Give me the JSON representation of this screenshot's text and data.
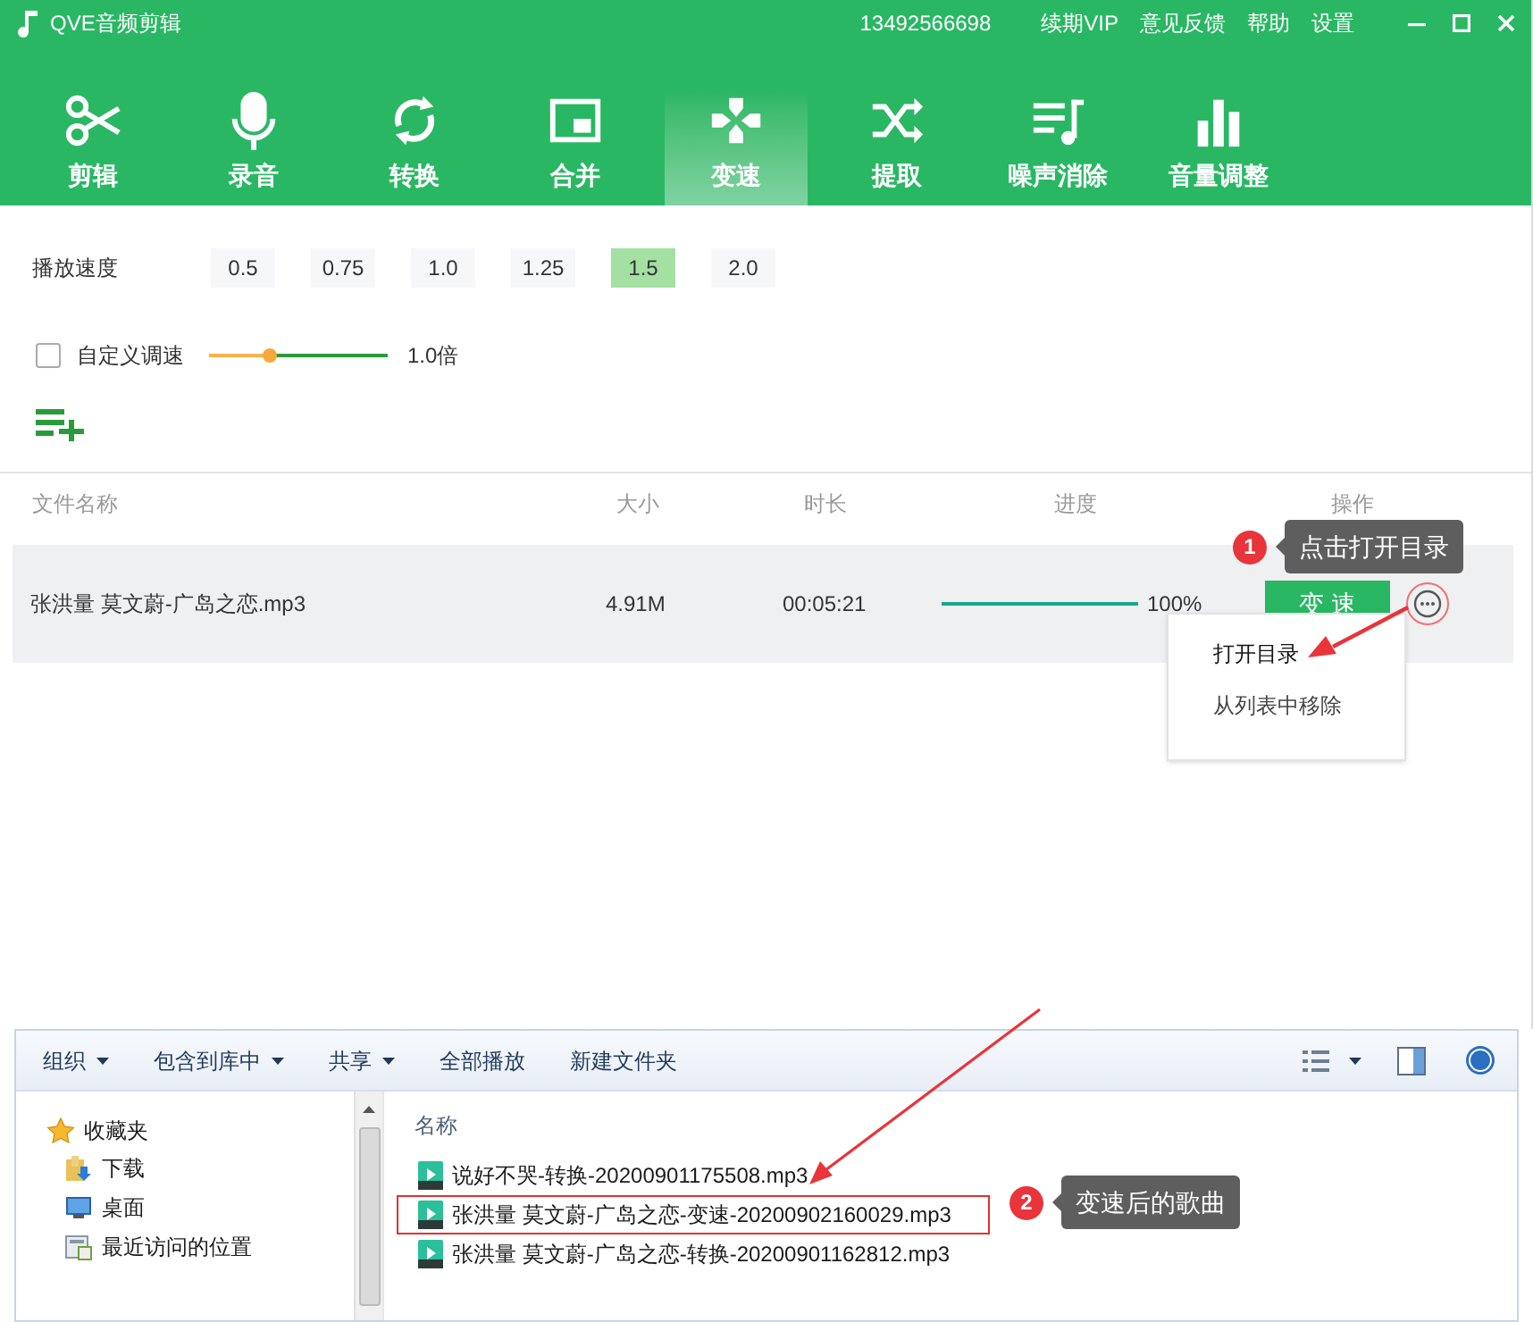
{
  "window": {
    "title": "QVE音频剪辑",
    "account": "13492566698",
    "menu": [
      "续期VIP",
      "意见反馈",
      "帮助",
      "设置"
    ]
  },
  "tools": [
    {
      "label": "剪辑",
      "selected": false
    },
    {
      "label": "录音",
      "selected": false
    },
    {
      "label": "转换",
      "selected": false
    },
    {
      "label": "合并",
      "selected": false
    },
    {
      "label": "变速",
      "selected": true
    },
    {
      "label": "提取",
      "selected": false
    },
    {
      "label": "噪声消除",
      "selected": false
    },
    {
      "label": "音量调整",
      "selected": false
    }
  ],
  "speed": {
    "label": "播放速度",
    "options": [
      {
        "label": "0.5",
        "selected": false
      },
      {
        "label": "0.75",
        "selected": false
      },
      {
        "label": "1.0",
        "selected": false
      },
      {
        "label": "1.25",
        "selected": false
      },
      {
        "label": "1.5",
        "selected": true
      },
      {
        "label": "2.0",
        "selected": false
      }
    ]
  },
  "custom_speed": {
    "label": "自定义调速",
    "checked": false,
    "level": 0.34,
    "reading": "1.0倍"
  },
  "table": {
    "columns": [
      "文件名称",
      "大小",
      "时长",
      "进度",
      "操作"
    ],
    "rows": [
      {
        "name": "张洪量 莫文蔚-广岛之恋.mp3",
        "size": "4.91M",
        "duration": "00:05:21",
        "level": 1,
        "progress": "100%",
        "action": "变 速"
      }
    ]
  },
  "context_menu": {
    "items": [
      "打开目录",
      "从列表中移除"
    ]
  },
  "callouts": [
    {
      "number": "1",
      "text": "点击打开目录"
    },
    {
      "number": "2",
      "text": "变速后的歌曲"
    }
  ],
  "explorer": {
    "toolbar": [
      {
        "label": "组织",
        "dropdown": true
      },
      {
        "label": "包含到库中",
        "dropdown": true
      },
      {
        "label": "共享",
        "dropdown": true
      },
      {
        "label": "全部播放",
        "dropdown": false
      },
      {
        "label": "新建文件夹",
        "dropdown": false
      }
    ],
    "nav": [
      {
        "label": "收藏夹",
        "children": [
          {
            "label": "下载"
          },
          {
            "label": "桌面"
          },
          {
            "label": "最近访问的位置"
          }
        ]
      }
    ],
    "column": "名称",
    "files": [
      {
        "name": "说好不哭-转换-20200901175508.mp3",
        "selected": false
      },
      {
        "name": "张洪量 莫文蔚-广岛之恋-变速-20200902160029.mp3",
        "selected": true
      },
      {
        "name": "张洪量 莫文蔚-广岛之恋-转换-20200901162812.mp3",
        "selected": false
      }
    ]
  }
}
